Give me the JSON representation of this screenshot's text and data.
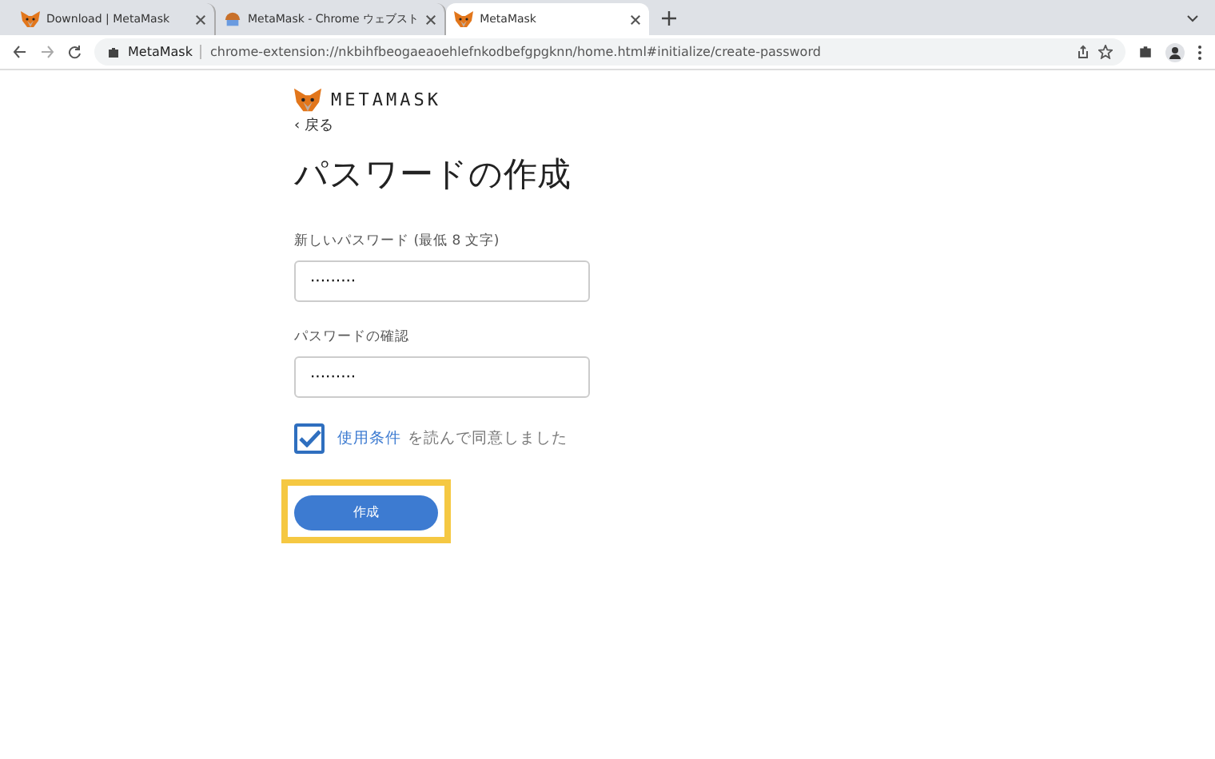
{
  "browser": {
    "tabs": [
      {
        "title": "Download | MetaMask",
        "selected": false,
        "kind": "fox"
      },
      {
        "title": "MetaMask - Chrome ウェブスト",
        "selected": false,
        "kind": "store"
      },
      {
        "title": "MetaMask",
        "selected": true,
        "kind": "fox"
      }
    ],
    "site_label": "MetaMask",
    "url": "chrome-extension://nkbihfbeogaeaoehlefnkodbefgpgknn/home.html#initialize/create-password"
  },
  "page": {
    "brand": "METAMASK",
    "back": "‹ 戻る",
    "title": "パスワードの作成",
    "fields": [
      {
        "label": "新しいパスワード (最低 8 文字)",
        "value": "·········"
      },
      {
        "label": "パスワードの確認",
        "value": "·········"
      }
    ],
    "terms": {
      "checked": true,
      "link": "使用条件",
      "text": "を読んで同意しました"
    },
    "create_button": {
      "label": "作成",
      "highlighted": true
    }
  }
}
